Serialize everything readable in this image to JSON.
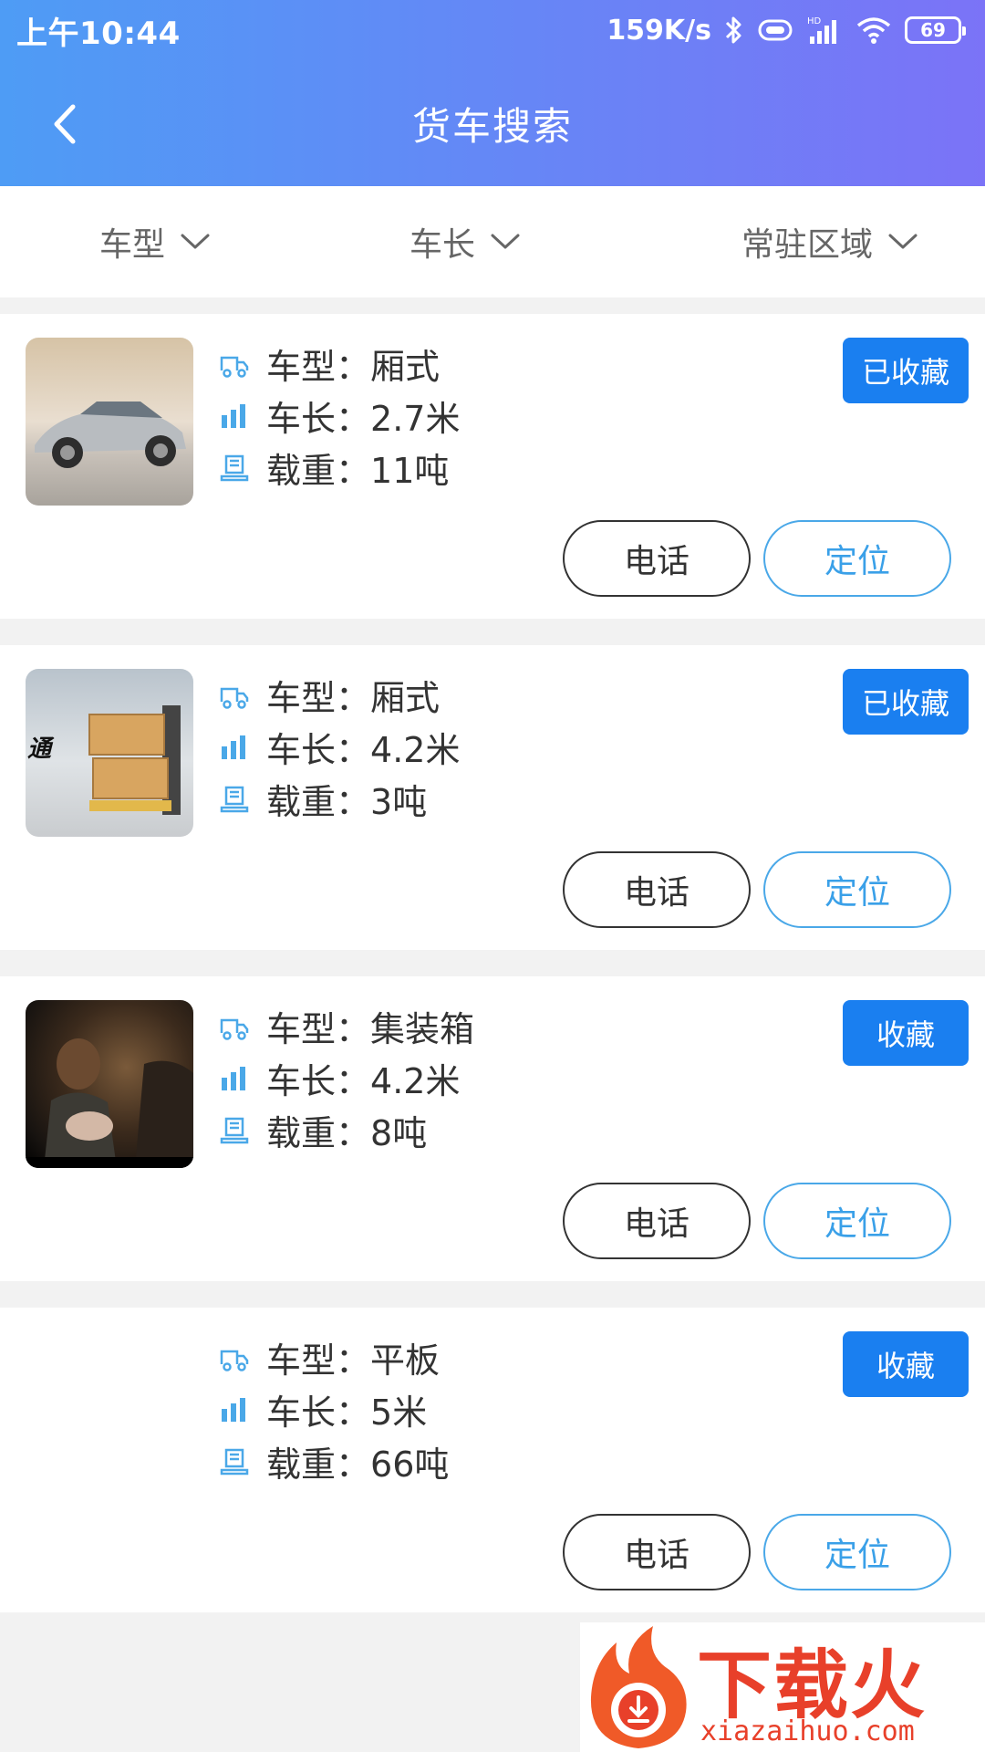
{
  "status_bar": {
    "time": "上午10:44",
    "net_speed": "159K/s",
    "battery": "69"
  },
  "header": {
    "title": "货车搜索"
  },
  "filters": [
    "车型",
    "车长",
    "常驻区域"
  ],
  "labels": {
    "type": "车型：",
    "length": "车长：",
    "load": "载重：",
    "call": "电话",
    "locate": "定位"
  },
  "cards": [
    {
      "type": "厢式",
      "length": "2.7米",
      "load": "11吨",
      "fav": "已收藏"
    },
    {
      "type": "厢式",
      "length": "4.2米",
      "load": "3吨",
      "fav": "已收藏"
    },
    {
      "type": "集装箱",
      "length": "4.2米",
      "load": "8吨",
      "fav": "收藏"
    },
    {
      "type": "平板",
      "length": "5米",
      "load": "66吨",
      "fav": "收藏"
    }
  ],
  "thumb_overlay": "通",
  "watermark": {
    "text": "下载火",
    "url": "xiazaihuo.com"
  },
  "colors": {
    "header_start": "#4e9cf5",
    "header_end": "#7b73f7",
    "fav_button": "#1a7ff0",
    "locate_accent": "#3aa0e8"
  }
}
